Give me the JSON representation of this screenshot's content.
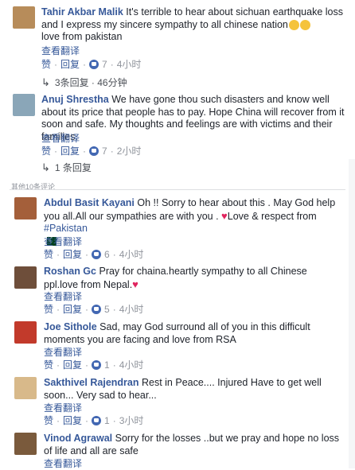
{
  "section_label": "其他10条评论",
  "comments": [
    {
      "author": "Tahir Akbar Malik",
      "text": "It's terrible to hear about sichuan earthquake loss and I express my sincere sympathy to all chinese nation",
      "text2": "love from pakistan",
      "translate": "查看翻译",
      "like": "赞",
      "reply": "回复",
      "count": "7",
      "time": "4小时",
      "replies": "3条回复 · 46分钟",
      "avatar_color": "#b78c5a"
    },
    {
      "author": "Anuj Shrestha",
      "text": "We have gone thou such disasters and know well about its price that people has to pay. Hope China will recover from it soon and safe. My thoughts and feelings are with victims and their families.",
      "translate": "查看翻译",
      "like": "赞",
      "reply": "回复",
      "count": "7",
      "time": "2小时",
      "replies": "1 条回复",
      "avatar_color": "#8aa6b8"
    },
    {
      "author": "Abdul Basit Kayani",
      "text": "Oh !! Sorry to hear about this . May God help you all.All our sympathies are with you .",
      "text_tail": "Love & respect from",
      "hashtag": "#Pakistan",
      "translate": "查看翻译",
      "like": "赞",
      "reply": "回复",
      "count": "6",
      "time": "4小时",
      "avatar_color": "#a45f3a"
    },
    {
      "author": "Roshan Gc",
      "text": "Pray for chaina.heartly sympathy to all Chinese ppl.love from Nepal.",
      "translate": "查看翻译",
      "like": "赞",
      "reply": "回复",
      "count": "5",
      "time": "4小时",
      "avatar_color": "#6e4e3a"
    },
    {
      "author": "Joe Sithole",
      "text": "Sad, may God surround all of you in this difficult moments you are facing and love from RSA",
      "translate": "查看翻译",
      "like": "赞",
      "reply": "回复",
      "count": "1",
      "time": "4小时",
      "avatar_color": "#c23a2b"
    },
    {
      "author": "Sakthivel Rajendran",
      "text": "Rest in Peace.... Injured Have to get well soon... Very sad to hear...",
      "translate": "查看翻译",
      "like": "赞",
      "reply": "回复",
      "count": "1",
      "time": "3小时",
      "avatar_color": "#d8b98a"
    },
    {
      "author": "Vinod Agrawal",
      "text": "Sorry for the losses ..but we pray and hope no loss of life and all are safe",
      "translate": "查看翻译",
      "avatar_color": "#7a5a3c"
    }
  ]
}
